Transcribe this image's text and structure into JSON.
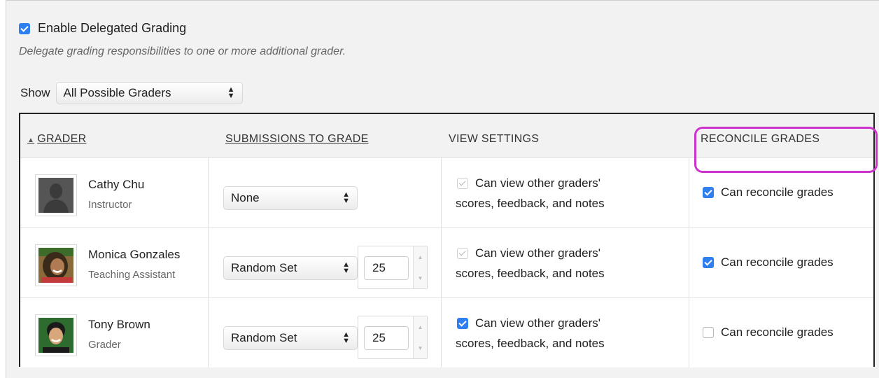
{
  "delegated": {
    "enable_label": "Enable Delegated Grading",
    "enabled": true,
    "description": "Delegate grading responsibilities to one or more additional grader."
  },
  "filter": {
    "show_label": "Show",
    "selected": "All Possible Graders"
  },
  "table": {
    "headers": {
      "grader": "GRADER",
      "submissions": "SUBMISSIONS TO GRADE",
      "view": "VIEW SETTINGS",
      "reconcile": "RECONCILE GRADES"
    },
    "rows": [
      {
        "name": "Cathy Chu",
        "role": "Instructor",
        "avatar": "placeholder-silhouette",
        "submissions": "None",
        "count": "",
        "view_line1": "Can view other graders'",
        "view_line2": "scores, feedback, and notes",
        "view_checked": true,
        "view_disabled": true,
        "reconcile_label": "Can reconcile grades",
        "reconcile_checked": true
      },
      {
        "name": "Monica Gonzales",
        "role": "Teaching Assistant",
        "avatar": "photo",
        "submissions": "Random Set",
        "count": "25",
        "view_line1": "Can view other graders'",
        "view_line2": "scores, feedback, and notes",
        "view_checked": true,
        "view_disabled": true,
        "reconcile_label": "Can reconcile grades",
        "reconcile_checked": true
      },
      {
        "name": "Tony Brown",
        "role": "Grader",
        "avatar": "photo",
        "submissions": "Random Set",
        "count": "25",
        "view_line1": "Can view other graders'",
        "view_line2": "scores, feedback, and notes",
        "view_checked": true,
        "view_disabled": false,
        "reconcile_label": "Can reconcile grades",
        "reconcile_checked": false
      }
    ]
  },
  "colors": {
    "accent": "#2f7ff0",
    "highlight": "#cc33cc"
  }
}
